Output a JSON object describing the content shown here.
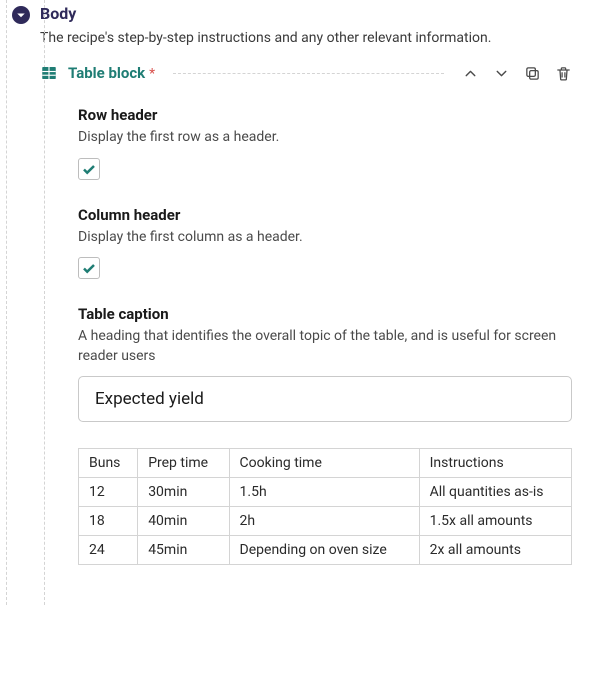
{
  "section": {
    "title": "Body",
    "description": "The recipe's step-by-step instructions and any other relevant information."
  },
  "block": {
    "label": "Table block",
    "required_marker": "*"
  },
  "fields": {
    "row_header": {
      "label": "Row header",
      "description": "Display the first row as a header.",
      "checked": true
    },
    "column_header": {
      "label": "Column header",
      "description": "Display the first column as a header.",
      "checked": true
    },
    "caption": {
      "label": "Table caption",
      "description": "A heading that identifies the overall topic of the table, and is useful for screen reader users",
      "value": "Expected yield"
    }
  },
  "table": {
    "headers": [
      "Buns",
      "Prep time",
      "Cooking time",
      "Instructions"
    ],
    "rows": [
      [
        "12",
        "30min",
        "1.5h",
        "All quantities as-is"
      ],
      [
        "18",
        "40min",
        "2h",
        "1.5x all amounts"
      ],
      [
        "24",
        "45min",
        "Depending on oven size",
        "2x all amounts"
      ]
    ]
  },
  "icons": {
    "collapse": "chevron-down-circle",
    "table": "table-icon",
    "move_up": "chevron-up-icon",
    "move_down": "chevron-down-icon",
    "duplicate": "copy-icon",
    "delete": "trash-icon"
  }
}
